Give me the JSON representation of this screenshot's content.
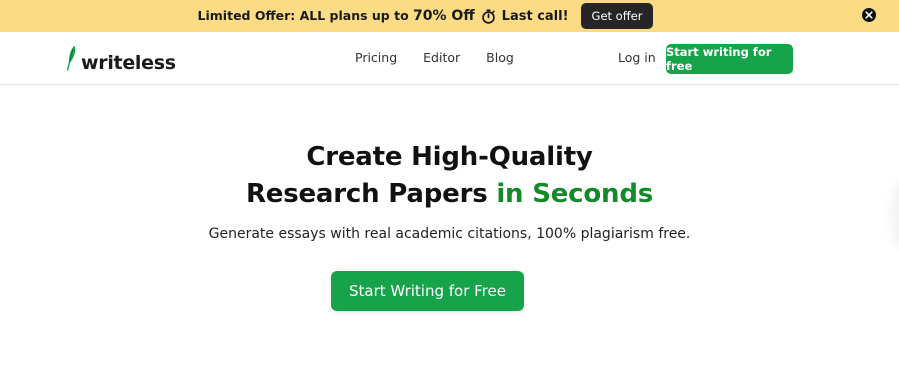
{
  "promo": {
    "prefix": "Limited Offer: ALL plans up to ",
    "highlight": "70% Off",
    "suffix": "Last call!",
    "button_label": "Get offer"
  },
  "nav": {
    "logo_text": "writeless",
    "links": [
      "Pricing",
      "Editor",
      "Blog"
    ],
    "login_label": "Log in",
    "cta_label": "Start writing for free"
  },
  "hero": {
    "title_line1": "Create High-Quality",
    "title_line2_main": "Research Papers ",
    "title_line2_accent": "in Seconds",
    "subtitle": "Generate essays with real academic citations, 100% plagiarism free.",
    "cta_label": "Start Writing for Free"
  },
  "colors": {
    "banner_bg": "#fbdc84",
    "brand_green": "#17a34a",
    "accent_text": "#128a2a",
    "dark_button": "#262626"
  },
  "icons": [
    "stopwatch-icon",
    "close-icon",
    "quill-logo-icon"
  ]
}
